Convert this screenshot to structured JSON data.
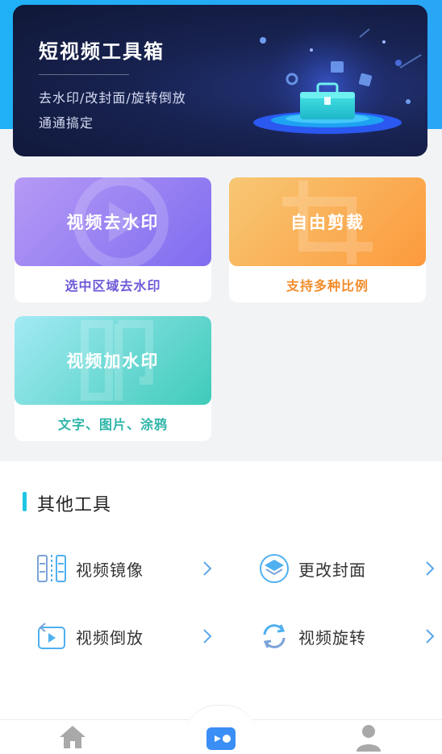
{
  "banner": {
    "title": "短视频工具箱",
    "subtitle_line1": "去水印/改封面/旋转倒放",
    "subtitle_line2": "通通搞定"
  },
  "cards": [
    {
      "title": "视频去水印",
      "subtitle": "选中区域去水印"
    },
    {
      "title": "自由剪裁",
      "subtitle": "支持多种比例"
    },
    {
      "title": "视频加水印",
      "subtitle": "文字、图片、涂鸦"
    }
  ],
  "other_tools": {
    "title": "其他工具",
    "items": [
      {
        "label": "视频镜像",
        "icon": "mirror-icon"
      },
      {
        "label": "更改封面",
        "icon": "cover-icon"
      },
      {
        "label": "视频倒放",
        "icon": "reverse-play-icon"
      },
      {
        "label": "视频旋转",
        "icon": "rotate-icon"
      }
    ]
  },
  "bottom_nav": {
    "items": [
      {
        "icon": "home-icon",
        "active": false
      },
      {
        "icon": "video-tools-icon",
        "active": true
      },
      {
        "icon": "profile-icon",
        "active": false
      }
    ]
  },
  "colors": {
    "accent": "#1ec6e3",
    "purple": "#7f6cf0",
    "orange": "#fd9a3d",
    "teal": "#3fcbb9",
    "banner_bg": "#17224f",
    "top_band": "#1fb0f5"
  }
}
